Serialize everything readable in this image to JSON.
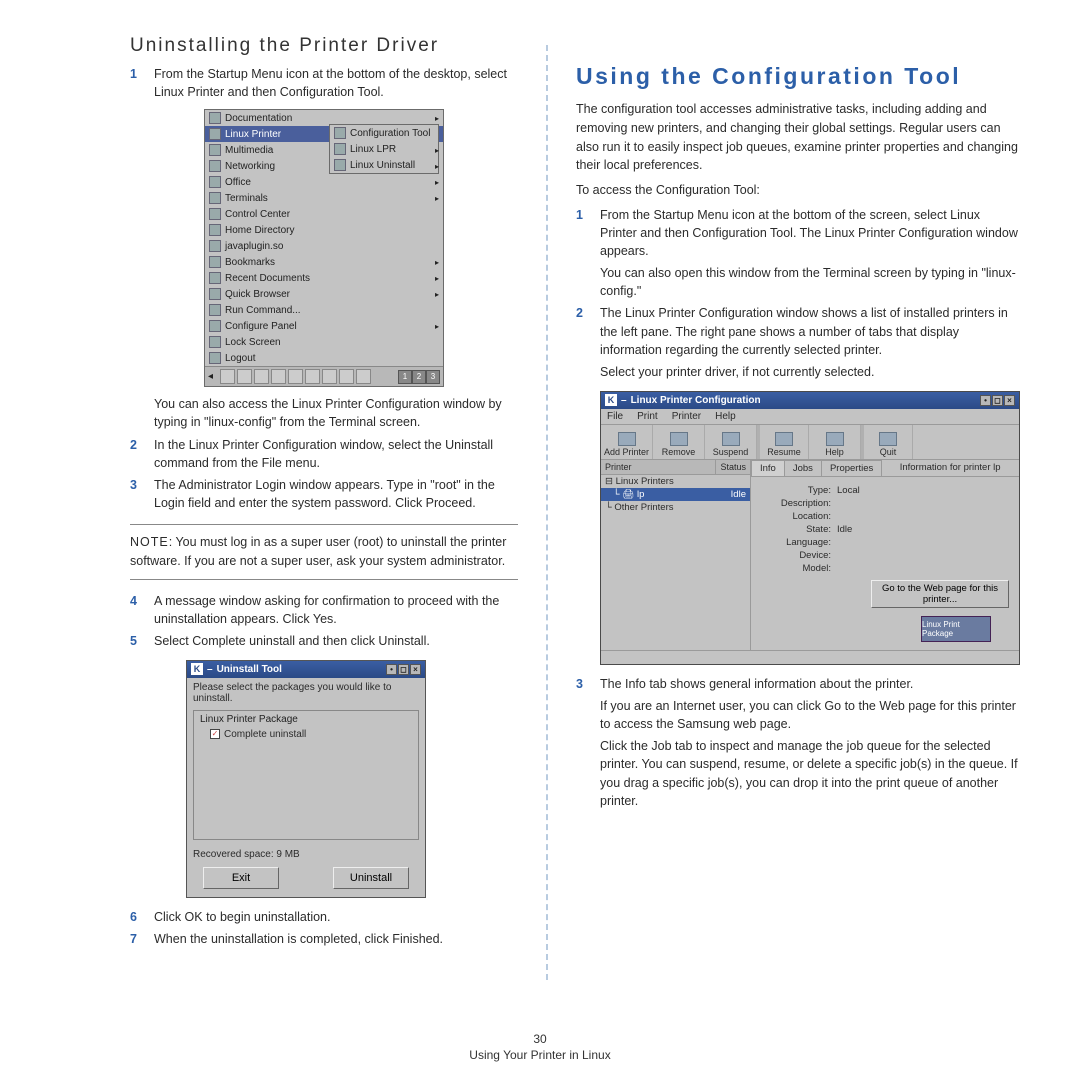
{
  "left": {
    "heading": "Uninstalling the Printer Driver",
    "step1": "From the Startup Menu icon at the bottom of the desktop, select Linux Printer and then Configuration Tool.",
    "step1b": "You can also access the Linux Printer Configuration window by typing in \"linux-config\" from the Terminal screen.",
    "step2": "In the Linux Printer Configuration window, select the Uninstall command from the File menu.",
    "step3": "The Administrator Login window appears. Type in \"root\" in the Login field and enter the system password. Click Proceed.",
    "note_label": "NOTE",
    "note": ": You must log in as a super user (root) to uninstall the printer software. If you are not a super user, ask your system administrator.",
    "step4": "A message window asking for confirmation to proceed with the uninstallation appears. Click Yes.",
    "step5": "Select Complete uninstall and then click Uninstall.",
    "step6": "Click OK to begin uninstallation.",
    "step7": "When the uninstallation is completed, click Finished."
  },
  "right": {
    "heading": "Using the Configuration Tool",
    "intro": "The configuration tool accesses administrative tasks, including adding and removing new printers, and changing their global settings. Regular users can also run it to easily inspect job queues, examine printer properties and changing their local preferences.",
    "access": "To access the Configuration Tool:",
    "step1": "From the Startup Menu icon at the bottom of the screen, select Linux Printer and then Configuration Tool. The Linux Printer Configuration window appears.",
    "step1b": "You can also open this window from the Terminal screen by typing in \"linux-config.\"",
    "step2": "The Linux Printer Configuration window shows a list of installed printers in the left pane. The right pane shows a number of tabs that display information regarding the currently selected printer.",
    "step2b": "Select your printer driver, if not currently selected.",
    "step3": "The Info tab shows general information about the printer.",
    "step3b": "If you are an Internet user, you can click Go to the Web page for this printer to access the Samsung web page.",
    "step3c": "Click the Job tab to inspect and manage the job queue for the selected printer. You can suspend, resume, or delete a specific job(s) in the queue. If you drag a specific job(s), you can drop it into the print queue of another printer."
  },
  "menu": {
    "items": [
      "Documentation",
      "Linux Printer",
      "Multimedia",
      "Networking",
      "Office",
      "Terminals",
      "Control Center",
      "Home Directory",
      "javaplugin.so",
      "Bookmarks",
      "Recent Documents",
      "Quick Browser",
      "Run Command...",
      "Configure Panel",
      "Lock Screen",
      "Logout"
    ],
    "sub": [
      "Configuration Tool",
      "Linux LPR",
      "Linux Uninstall"
    ]
  },
  "uninst": {
    "title": "Uninstall Tool",
    "prompt": "Please select the packages you would like to uninstall.",
    "group": "Linux Printer Package",
    "opt": "Complete uninstall",
    "recovered": "Recovered space:  9 MB",
    "exit": "Exit",
    "uninstall": "Uninstall"
  },
  "cfg": {
    "title": "Linux Printer Configuration",
    "menus": [
      "File",
      "Print",
      "Printer",
      "Help"
    ],
    "buttons": [
      "Add Printer",
      "Remove",
      "Suspend",
      "Resume",
      "Help",
      "Quit"
    ],
    "tree_head": [
      "Printer",
      "Status"
    ],
    "tree": [
      "Linux Printers",
      "lp",
      "Other Printers"
    ],
    "tree_status": "Idle",
    "tabs": [
      "Info",
      "Jobs",
      "Properties"
    ],
    "info_head": "Information for printer lp",
    "rows": [
      [
        "Type:",
        "Local"
      ],
      [
        "Description:",
        ""
      ],
      [
        "Location:",
        ""
      ],
      [
        "State:",
        "Idle"
      ],
      [
        "Language:",
        ""
      ],
      [
        "Device:",
        ""
      ],
      [
        "Model:",
        ""
      ]
    ],
    "go": "Go to the Web page for this printer...",
    "logo": "Linux Print Package"
  },
  "footer": {
    "page": "30",
    "caption": "Using Your Printer in Linux"
  }
}
